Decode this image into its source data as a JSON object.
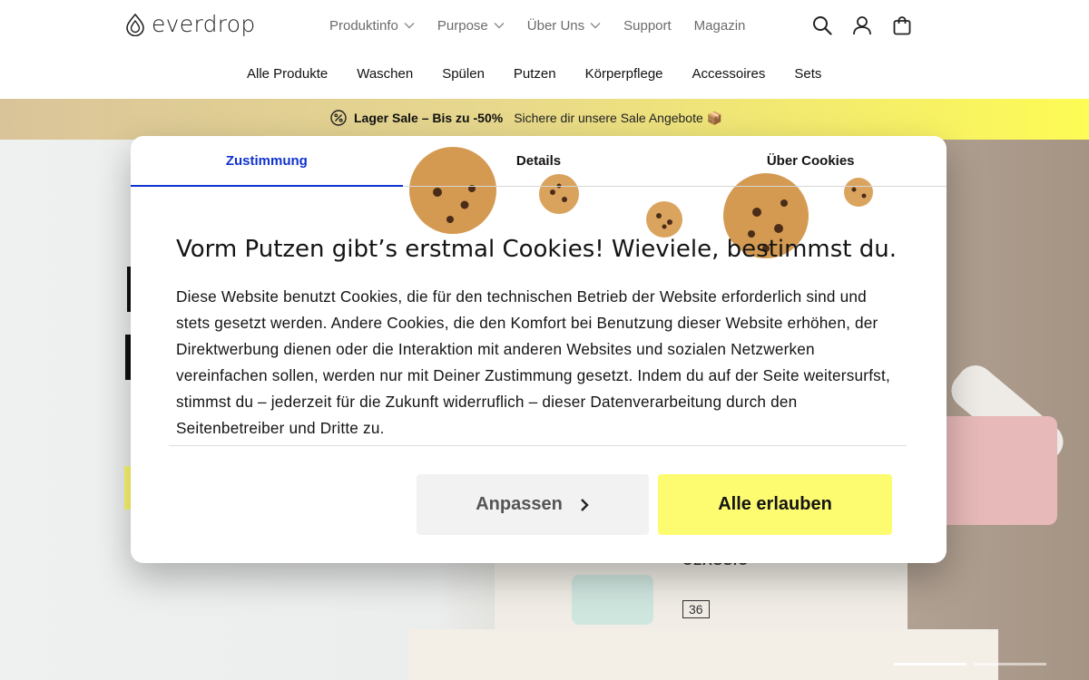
{
  "brand": {
    "name": "everdrop"
  },
  "header": {
    "nav": [
      {
        "label": "Produktinfo",
        "has_dropdown": true
      },
      {
        "label": "Purpose",
        "has_dropdown": true
      },
      {
        "label": "Über Uns",
        "has_dropdown": true
      },
      {
        "label": "Support",
        "has_dropdown": false
      },
      {
        "label": "Magazin",
        "has_dropdown": false
      }
    ],
    "icons": [
      "search-icon",
      "account-icon",
      "cart-icon"
    ]
  },
  "categories": [
    "Alle Produkte",
    "Waschen",
    "Spülen",
    "Putzen",
    "Körperpflege",
    "Accessoires",
    "Sets"
  ],
  "promo": {
    "icon": "percent-icon",
    "headline": "Lager Sale – Bis zu -50%",
    "text": "Sichere dir unsere Sale Angebote 📦"
  },
  "hero": {
    "product_label": "CLASSIC",
    "product_badge": "36",
    "brand_watermark": "everdrop",
    "slides": 2,
    "active_slide": 1
  },
  "cookie_modal": {
    "tabs": [
      {
        "label": "Zustimmung",
        "active": true
      },
      {
        "label": "Details",
        "active": false
      },
      {
        "label": "Über Cookies",
        "active": false
      }
    ],
    "title": "Vorm Putzen gibt’s erstmal Cookies! Wieviele, bestimmst du.",
    "body": "Diese Website benutzt Cookies, die für den technischen Betrieb der Website erforderlich sind und stets gesetzt werden. Andere Cookies, die den Komfort bei Benutzung dieser Website erhöhen, der Direktwerbung dienen oder die Interaktion mit anderen Websites und sozialen Netzwerken vereinfachen sollen, werden nur mit Deiner Zustimmung gesetzt. Indem du auf der Seite weitersurfst, stimmst du – jederzeit für die Zukunft widerruflich – dieser Datenverarbeitung durch den Seitenbetreiber und Dritte zu.",
    "customize_label": "Anpassen",
    "allow_all_label": "Alle erlauben"
  },
  "colors": {
    "accent_yellow": "#fdfb70",
    "active_tab_blue": "#1032cf",
    "text": "#141414",
    "nav_text": "#6b6b6b"
  }
}
